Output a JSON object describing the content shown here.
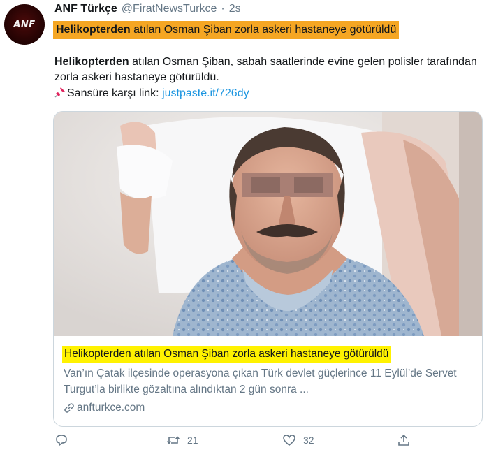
{
  "author": {
    "avatar_text": "ANF",
    "name": "ANF Türkçe",
    "handle": "@FiratNewsTurkce",
    "separator": "·",
    "time": "2s"
  },
  "headline": {
    "bold": "Helikopterden",
    "rest": " atılan Osman Şiban zorla askeri hastaneye götürüldü"
  },
  "body": {
    "bold": "Helikopterden",
    "rest": " atılan Osman Şiban, sabah saatlerinde evine gelen polisler tarafından zorla askeri hastaneye götürüldü.",
    "censor_label": "Sansüre karşı link: ",
    "censor_link": "justpaste.it/726dy"
  },
  "card": {
    "title": "Helikopterden atılan Osman Şiban zorla askeri hastaneye götürüldü",
    "description": "Van’ın Çatak ilçesinde operasyona çıkan Türk devlet güçlerince 11 Eylül’de Servet Turgut’la birlikte gözaltına alındıktan 2 gün sonra ...",
    "domain": "anfturkce.com"
  },
  "actions": {
    "reply_count": "",
    "retweet_count": "21",
    "like_count": "32"
  },
  "colors": {
    "headline_highlight": "#f5a623",
    "card_title_highlight": "#fff200",
    "link": "#1b95e0",
    "muted": "#657786"
  }
}
